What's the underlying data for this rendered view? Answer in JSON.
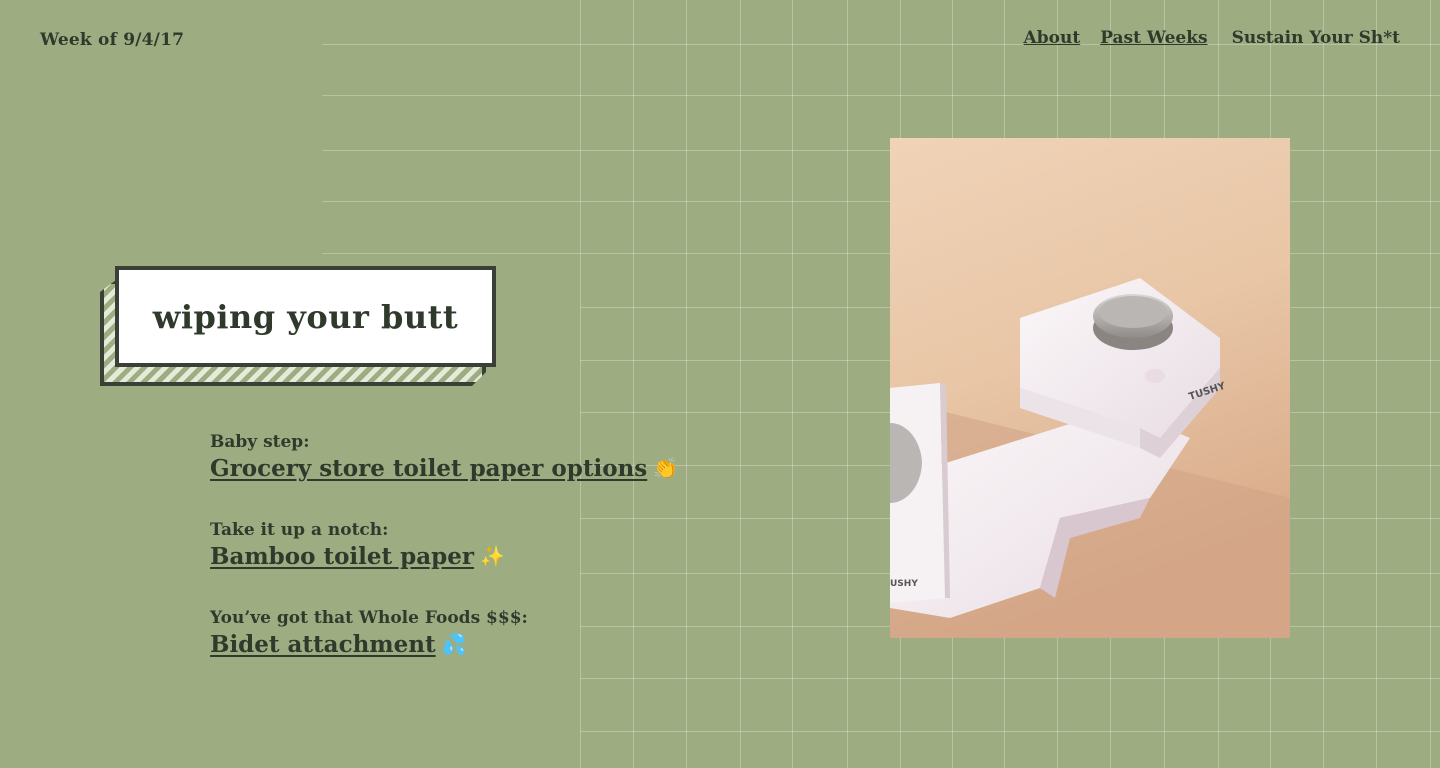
{
  "header": {
    "week_label": "Week of 9/4/17",
    "nav": [
      {
        "label": "About"
      },
      {
        "label": "Past Weeks"
      },
      {
        "label": "Sustain Your Sh*t"
      }
    ]
  },
  "hero": {
    "title": "wiping your butt"
  },
  "options": [
    {
      "label": "Baby step:",
      "link": "Grocery store toilet paper options",
      "emoji": "👏"
    },
    {
      "label": "Take it up a notch:",
      "link": "Bamboo toilet paper",
      "emoji": "✨"
    },
    {
      "label": "You’ve got that Whole Foods $$$:",
      "link": "Bidet attachment",
      "emoji": "💦"
    }
  ],
  "photo": {
    "brand_text_main": "TUSHY",
    "brand_text_partial": "USHY"
  },
  "colors": {
    "background": "#9dac81",
    "text": "#2f3a2c",
    "photo_bg": "#efd3b8",
    "device": "#f7f2f5"
  }
}
